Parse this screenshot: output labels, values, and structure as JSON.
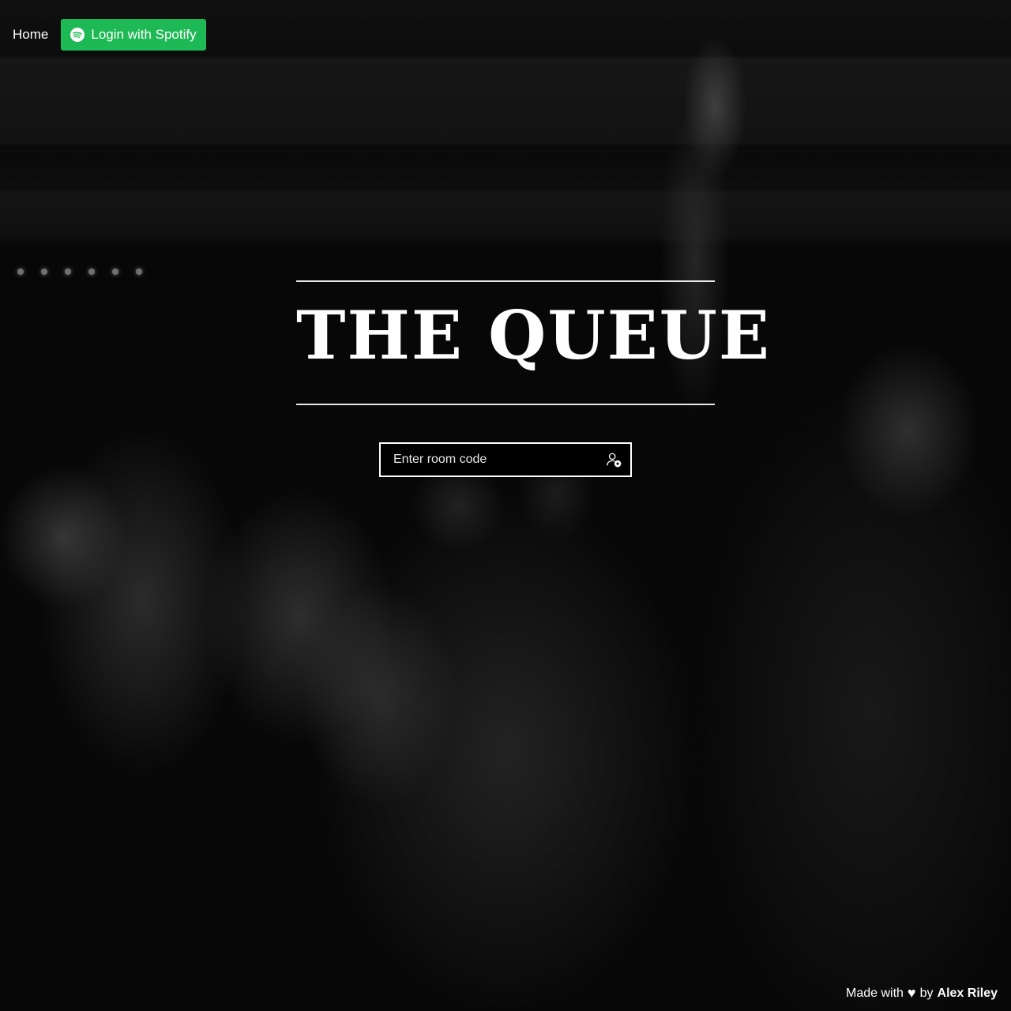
{
  "nav": {
    "home_label": "Home",
    "spotify_label": "Login with Spotify",
    "spotify_icon": "spotify-icon",
    "spotify_color": "#1db954"
  },
  "hero": {
    "title": "THE QUEUE"
  },
  "room": {
    "placeholder": "Enter room code",
    "value": "",
    "join_icon": "user-join-icon"
  },
  "footer": {
    "made_with": "Made with",
    "heart_icon": "heart-icon",
    "by": "by",
    "author": "Alex Riley"
  }
}
